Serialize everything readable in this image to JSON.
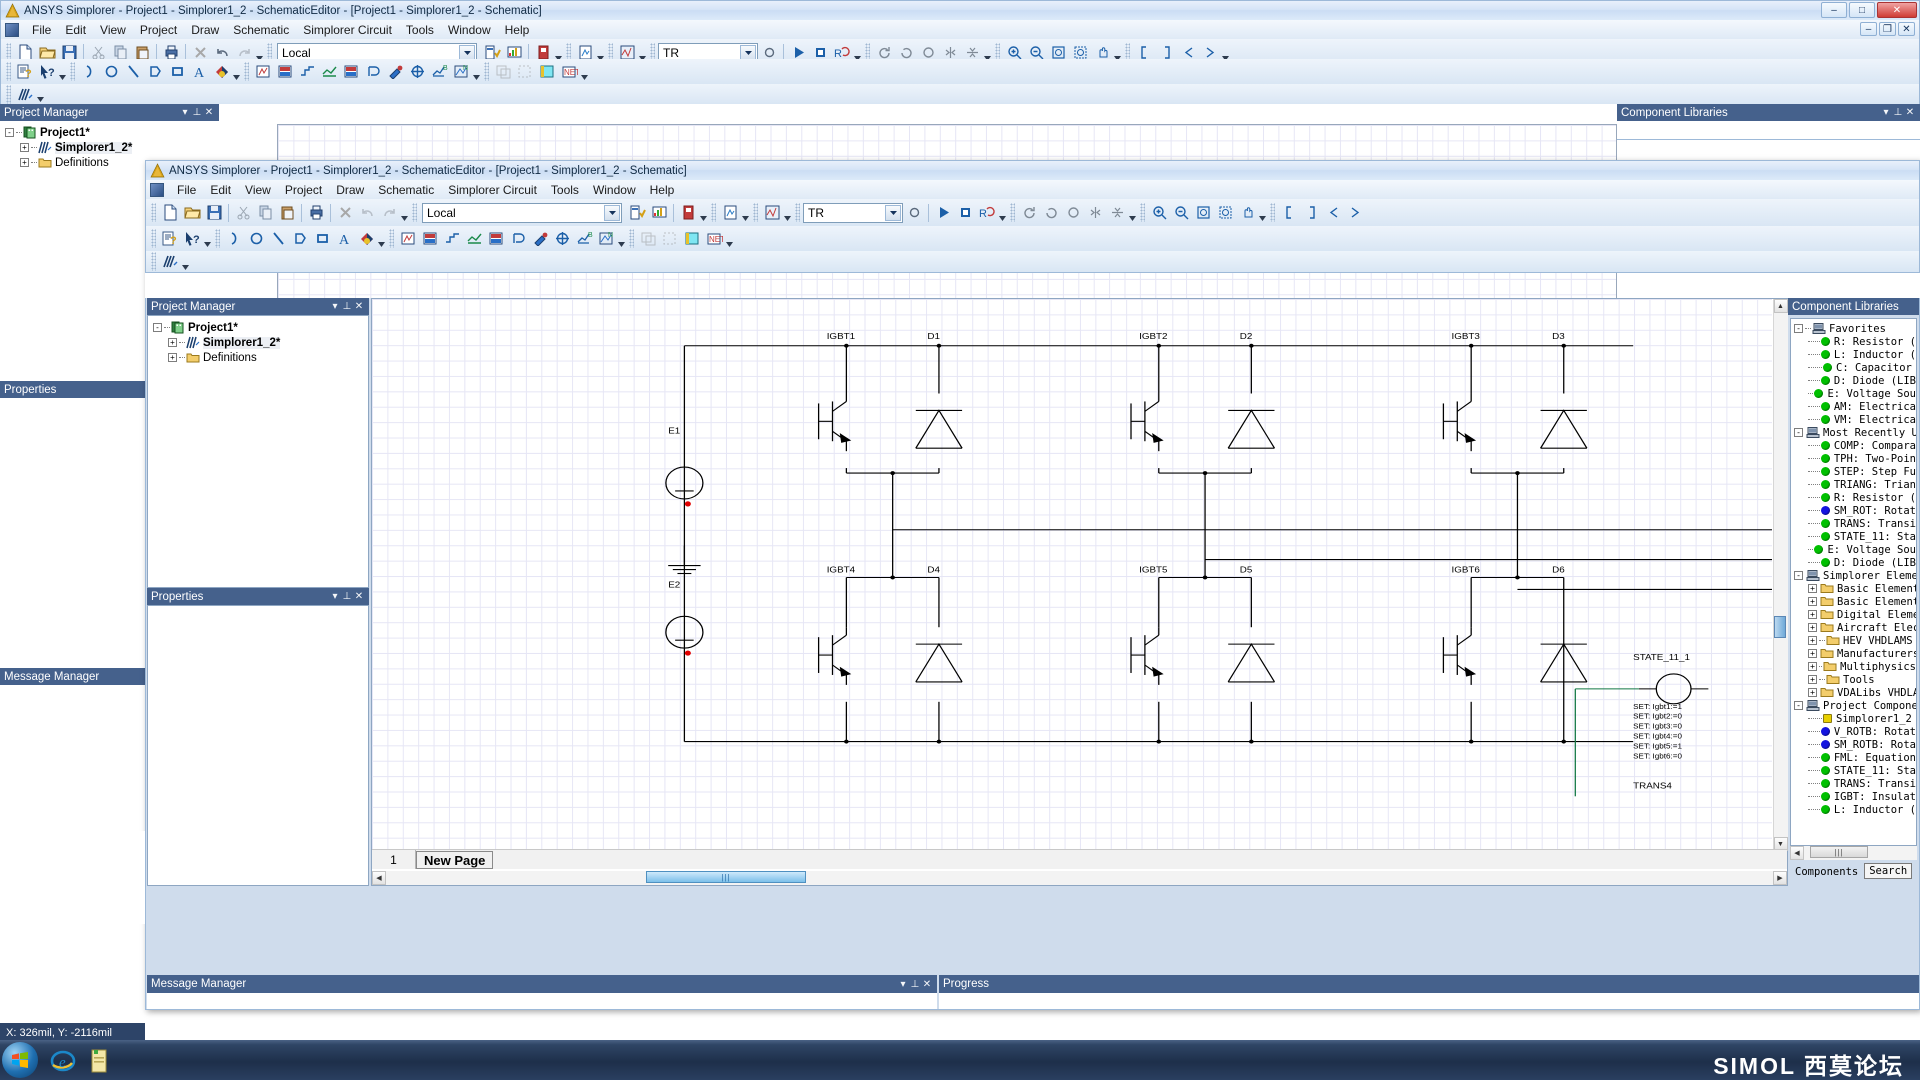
{
  "outer_window": {
    "title": "ANSYS Simplorer - Project1 - Simplorer1_2 - SchematicEditor - [Project1 - Simplorer1_2 - Schematic]",
    "app_icon": "ansys-logo-icon",
    "buttons": {
      "minimize": "–",
      "maximize": "□",
      "close": "✕",
      "inner_minimize": "–",
      "inner_restore": "❐",
      "inner_close": "✕"
    },
    "menu": [
      "File",
      "Edit",
      "View",
      "Project",
      "Draw",
      "Schematic",
      "Simplorer Circuit",
      "Tools",
      "Window",
      "Help"
    ],
    "solution_combo": {
      "value": "Local"
    },
    "analysis_combo": {
      "value": "TR"
    }
  },
  "inner_window": {
    "title": "ANSYS Simplorer - Project1 - Simplorer1_2 - SchematicEditor - [Project1 - Simplorer1_2 - Schematic]",
    "app_icon": "ansys-logo-icon",
    "menu": [
      "File",
      "Edit",
      "View",
      "Project",
      "Draw",
      "Schematic",
      "Simplorer Circuit",
      "Tools",
      "Window",
      "Help"
    ],
    "solution_combo": {
      "value": "Local"
    },
    "analysis_combo": {
      "value": "TR"
    }
  },
  "outer_project_manager": {
    "title": "Project Manager",
    "controls": {
      "menu": "▾",
      "pin": "⊥",
      "close": "✕"
    },
    "tree": [
      {
        "label": "Project1*",
        "icon": "project-icon",
        "expander": "-",
        "depth": 0,
        "bold": true
      },
      {
        "label": "Simplorer1_2*",
        "icon": "simplorer-design-icon",
        "expander": "+",
        "depth": 1,
        "bold": true
      },
      {
        "label": "Definitions",
        "icon": "folder-icon",
        "expander": "+",
        "depth": 1,
        "bold": false
      }
    ]
  },
  "outer_properties": {
    "title": "Properties"
  },
  "outer_message_manager": {
    "title": "Message Manager"
  },
  "outer_component_libraries": {
    "title": "Component Libraries",
    "controls": {
      "menu": "▾",
      "pin": "⊥",
      "close": "✕"
    }
  },
  "inner_project_manager": {
    "title": "Project Manager",
    "controls": {
      "menu": "▾",
      "pin": "⊥",
      "close": "✕"
    },
    "tree": [
      {
        "label": "Project1*",
        "icon": "project-icon",
        "expander": "-",
        "depth": 0,
        "bold": true
      },
      {
        "label": "Simplorer1_2*",
        "icon": "simplorer-design-icon",
        "expander": "+",
        "depth": 1,
        "bold": true,
        "selected": true
      },
      {
        "label": "Definitions",
        "icon": "folder-icon",
        "expander": "+",
        "depth": 1,
        "bold": false
      }
    ]
  },
  "inner_properties": {
    "title": "Properties",
    "controls": {
      "menu": "▾",
      "pin": "⊥",
      "close": "✕"
    }
  },
  "inner_message_manager": {
    "title": "Message Manager",
    "controls": {
      "menu": "▾",
      "pin": "⊥",
      "close": "✕"
    }
  },
  "progress_panel": {
    "title": "Progress"
  },
  "component_libraries": {
    "title": "Component Libraries",
    "tabs": [
      {
        "label": "Components",
        "active": true
      },
      {
        "label": "Search",
        "active": false
      }
    ],
    "tree": [
      {
        "label": "Favorites",
        "type": "root",
        "expander": "-",
        "icon": "computer-icon",
        "depth": 0
      },
      {
        "label": "R: Resistor (",
        "type": "leaf",
        "dot": "#00c000",
        "depth": 1
      },
      {
        "label": "L: Inductor (",
        "type": "leaf",
        "dot": "#00c000",
        "depth": 1
      },
      {
        "label": "C: Capacitor",
        "type": "leaf",
        "dot": "#00c000",
        "depth": 1
      },
      {
        "label": "D: Diode (LIB",
        "type": "leaf",
        "dot": "#00c000",
        "depth": 1
      },
      {
        "label": "E: Voltage Sou",
        "type": "leaf",
        "dot": "#00c000",
        "depth": 1
      },
      {
        "label": "AM: Electrica",
        "type": "leaf",
        "dot": "#00c000",
        "depth": 1
      },
      {
        "label": "VM: Electrica",
        "type": "leaf",
        "dot": "#00c000",
        "depth": 1
      },
      {
        "label": "Most Recently Use",
        "type": "root",
        "expander": "-",
        "icon": "computer-icon",
        "depth": 0
      },
      {
        "label": "COMP: Compara",
        "type": "leaf",
        "dot": "#00c000",
        "depth": 1
      },
      {
        "label": "TPH: Two-Poin",
        "type": "leaf",
        "dot": "#00c000",
        "depth": 1
      },
      {
        "label": "STEP: Step Fu",
        "type": "leaf",
        "dot": "#00c000",
        "depth": 1
      },
      {
        "label": "TRIANG: Trian",
        "type": "leaf",
        "dot": "#00c000",
        "depth": 1
      },
      {
        "label": "R: Resistor (",
        "type": "leaf",
        "dot": "#00c000",
        "depth": 1
      },
      {
        "label": "SM_ROT: Rotat",
        "type": "leaf",
        "dot": "#1414e0",
        "depth": 1
      },
      {
        "label": "TRANS: Transi",
        "type": "leaf",
        "dot": "#00c000",
        "depth": 1
      },
      {
        "label": "STATE_11: Sta",
        "type": "leaf",
        "dot": "#00c000",
        "depth": 1
      },
      {
        "label": "E: Voltage Sou",
        "type": "leaf",
        "dot": "#00c000",
        "depth": 1
      },
      {
        "label": "D: Diode (LIB",
        "type": "leaf",
        "dot": "#00c000",
        "depth": 1
      },
      {
        "label": "Simplorer Element",
        "type": "root",
        "expander": "-",
        "icon": "computer-icon",
        "depth": 0
      },
      {
        "label": "Basic Element",
        "type": "folder",
        "expander": "+",
        "depth": 1
      },
      {
        "label": "Basic Element",
        "type": "folder",
        "expander": "+",
        "depth": 1
      },
      {
        "label": "Digital Elemen",
        "type": "folder",
        "expander": "+",
        "depth": 1
      },
      {
        "label": "Aircraft Elec",
        "type": "folder",
        "expander": "+",
        "depth": 1
      },
      {
        "label": "HEV VHDLAMS",
        "type": "folder",
        "expander": "+",
        "depth": 1
      },
      {
        "label": "Manufacturers",
        "type": "folder",
        "expander": "+",
        "depth": 1
      },
      {
        "label": "Multiphysics",
        "type": "folder",
        "expander": "+",
        "depth": 1
      },
      {
        "label": "Tools",
        "type": "folder",
        "expander": "+",
        "depth": 1
      },
      {
        "label": "VDALibs VHDLAM",
        "type": "folder",
        "expander": "+",
        "depth": 1
      },
      {
        "label": "Project Componen",
        "type": "root",
        "expander": "-",
        "icon": "computer-icon",
        "depth": 0
      },
      {
        "label": "Simplorer1_2",
        "type": "leaf",
        "dot": "#e8d000",
        "square": true,
        "depth": 1
      },
      {
        "label": "V_ROTB: Rotat",
        "type": "leaf",
        "dot": "#1414e0",
        "depth": 1
      },
      {
        "label": "SM_ROTB: Rota",
        "type": "leaf",
        "dot": "#1414e0",
        "depth": 1
      },
      {
        "label": "FML: Equation",
        "type": "leaf",
        "dot": "#00c000",
        "depth": 1
      },
      {
        "label": "STATE_11: Sta",
        "type": "leaf",
        "dot": "#00c000",
        "depth": 1
      },
      {
        "label": "TRANS: Transi",
        "type": "leaf",
        "dot": "#00c000",
        "depth": 1
      },
      {
        "label": "IGBT: Insulat",
        "type": "leaf",
        "dot": "#00c000",
        "depth": 1
      },
      {
        "label": "L: Inductor (",
        "type": "leaf",
        "dot": "#00c000",
        "depth": 1
      }
    ]
  },
  "schematic": {
    "page_number": "1",
    "page_tab": "New Page",
    "component_labels": {
      "igbt_top": [
        "IGBT1",
        "IGBT2",
        "IGBT3"
      ],
      "diode_top": [
        "D1",
        "D2",
        "D3"
      ],
      "igbt_bottom": [
        "IGBT4",
        "IGBT5",
        "IGBT6"
      ],
      "diode_bottom": [
        "D4",
        "D5",
        "D6"
      ],
      "sources": [
        "E1",
        "E2"
      ],
      "state_block": "STATE_11_1",
      "trans_block": "TRANS4"
    },
    "state_assignments": [
      "SET: Igbt1:=1",
      "SET: Igbt2:=0",
      "SET: Igbt3:=0",
      "SET: Igbt4:=0",
      "SET: Igbt5:=1",
      "SET: Igbt6:=0"
    ]
  },
  "statusbar": {
    "coordinates": "X: 326mil, Y: -2116mil"
  },
  "taskbar": {
    "start_button": "windows-start-icon",
    "items": [
      "internet-explorer-icon",
      "explorer-icon"
    ],
    "watermark": "SIMOL 西莫论坛"
  },
  "colors": {
    "panel_title_bg": "#45618c",
    "statusbar_bg": "#2d4468",
    "accent_blue": "#1b5fa8",
    "wire_black": "#000000",
    "wire_green": "#117744",
    "node_red": "#e00000"
  }
}
